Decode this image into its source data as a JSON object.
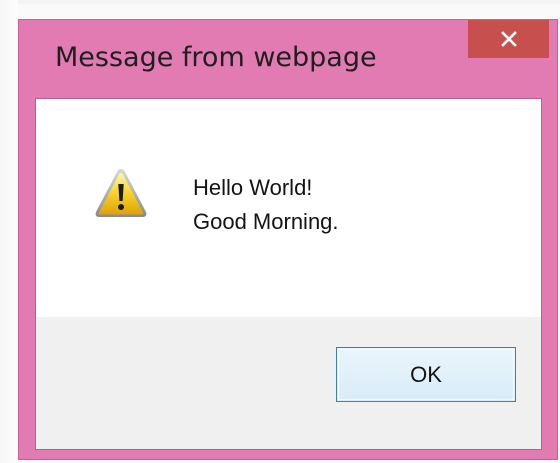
{
  "dialog": {
    "title": "Message from webpage",
    "close_icon": "close-icon",
    "warning_icon": "warning-icon",
    "message_lines": [
      "Hello World!",
      "Good Morning."
    ],
    "ok_label": "OK"
  },
  "colors": {
    "frame": "#e27bb1",
    "close_button": "#c7504e",
    "footer": "#f0f0f0",
    "ok_border": "#3c7fb1"
  }
}
